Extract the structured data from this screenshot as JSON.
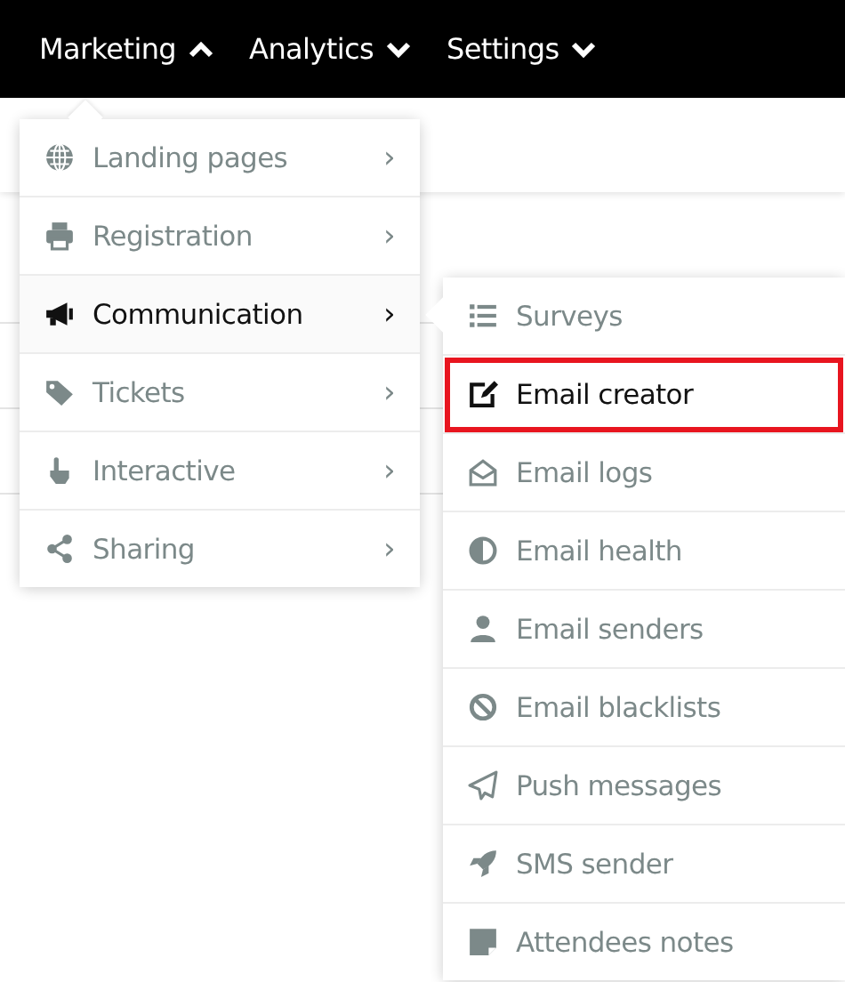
{
  "nav": [
    {
      "label": "Marketing",
      "expanded": true
    },
    {
      "label": "Analytics",
      "expanded": false
    },
    {
      "label": "Settings",
      "expanded": false
    }
  ],
  "menu": {
    "items": [
      {
        "label": "Landing pages",
        "chevron": "›",
        "selected": false
      },
      {
        "label": "Registration",
        "chevron": "›",
        "selected": false
      },
      {
        "label": "Communication",
        "chevron": "›",
        "selected": true
      },
      {
        "label": "Tickets",
        "chevron": "›",
        "selected": false
      },
      {
        "label": "Interactive",
        "chevron": "›",
        "selected": false
      },
      {
        "label": "Sharing",
        "chevron": "›",
        "selected": false
      }
    ]
  },
  "submenu": {
    "items": [
      {
        "label": "Surveys",
        "selected": false,
        "highlighted": false
      },
      {
        "label": "Email creator",
        "selected": true,
        "highlighted": true
      },
      {
        "label": "Email logs",
        "selected": false,
        "highlighted": false
      },
      {
        "label": "Email health",
        "selected": false,
        "highlighted": false
      },
      {
        "label": "Email senders",
        "selected": false,
        "highlighted": false
      },
      {
        "label": "Email blacklists",
        "selected": false,
        "highlighted": false
      },
      {
        "label": "Push messages",
        "selected": false,
        "highlighted": false
      },
      {
        "label": "SMS sender",
        "selected": false,
        "highlighted": false
      },
      {
        "label": "Attendees notes",
        "selected": false,
        "highlighted": false
      }
    ]
  }
}
